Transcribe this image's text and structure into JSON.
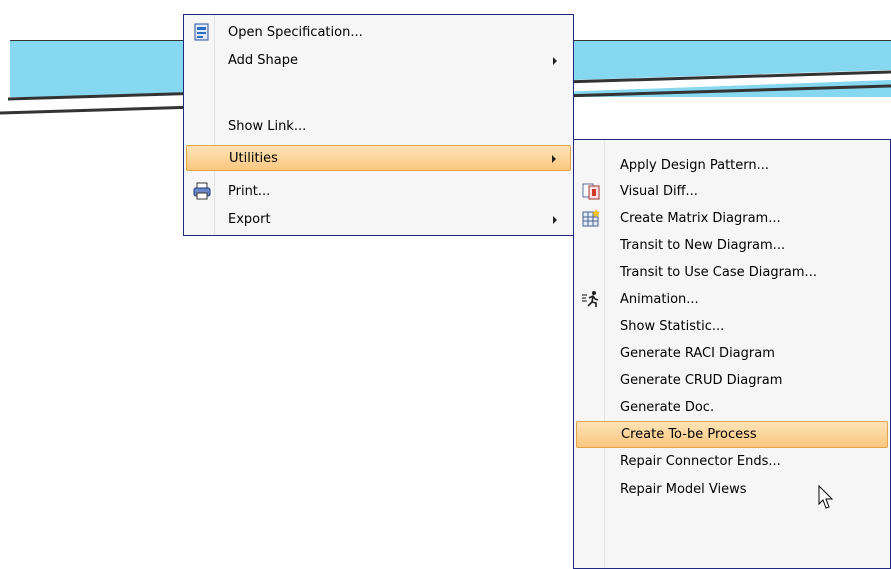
{
  "context_menu": {
    "items": [
      {
        "label": "Open Specification...",
        "icon": "specification-icon",
        "submenu": false
      },
      {
        "label": "Add Shape",
        "icon": "",
        "submenu": true
      },
      {
        "label": "Show Link...",
        "icon": "",
        "submenu": false
      },
      {
        "label": "Utilities",
        "icon": "",
        "submenu": true,
        "highlighted": true
      },
      {
        "label": "Print...",
        "icon": "printer-icon",
        "submenu": false
      },
      {
        "label": "Export",
        "icon": "",
        "submenu": true
      }
    ]
  },
  "submenu": {
    "items": [
      {
        "label": "Apply Design Pattern..."
      },
      {
        "label": "Visual Diff...",
        "icon": "visual-diff-icon"
      },
      {
        "label": "Create Matrix Diagram...",
        "icon": "matrix-diagram-icon"
      },
      {
        "label": "Transit to New Diagram..."
      },
      {
        "label": "Transit to Use Case Diagram..."
      },
      {
        "label": "Animation...",
        "icon": "animation-runner-icon"
      },
      {
        "label": "Show Statistic..."
      },
      {
        "label": "Generate RACI Diagram"
      },
      {
        "label": "Generate CRUD Diagram"
      },
      {
        "label": "Generate Doc."
      },
      {
        "label": "Create To-be Process",
        "highlighted": true
      },
      {
        "label": "Repair Connector Ends..."
      },
      {
        "label": "Repair Model Views"
      }
    ]
  },
  "colors": {
    "menu_border": "#1e2a80",
    "highlight_top": "#fde3b6",
    "highlight_bottom": "#fbc77f",
    "diagram_band": "#86d8f0"
  }
}
